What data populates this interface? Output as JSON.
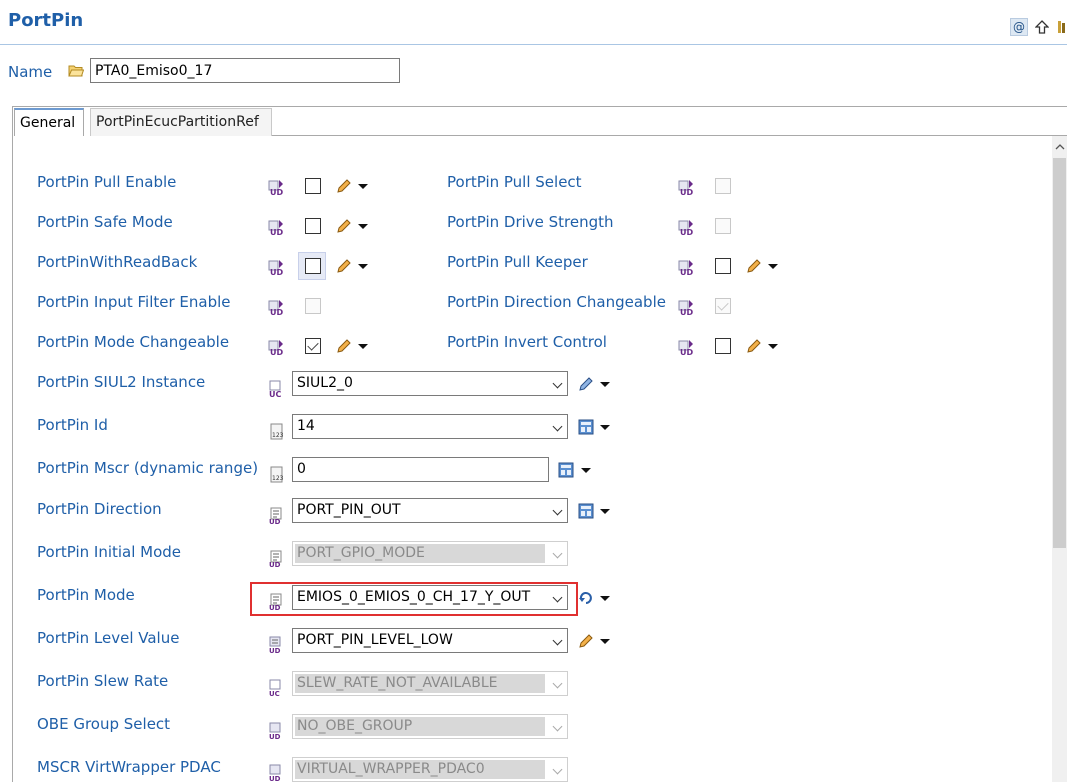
{
  "header": {
    "title": "PortPin"
  },
  "top_icons": [
    "at-icon",
    "up-arrow-icon",
    "library-icon"
  ],
  "name_field": {
    "label": "Name",
    "value": "PTA0_Emiso0_17"
  },
  "tabs": [
    {
      "label": "General",
      "active": true
    },
    {
      "label": "PortPinEcucPartitionRef",
      "active": false
    }
  ],
  "left_checks": [
    {
      "label": "PortPin Pull Enable",
      "checked": false,
      "enabled": true
    },
    {
      "label": "PortPin Safe Mode",
      "checked": false,
      "enabled": true
    },
    {
      "label": "PortPinWithReadBack",
      "checked": false,
      "enabled": true
    },
    {
      "label": "PortPin Input Filter Enable",
      "checked": false,
      "enabled": false
    },
    {
      "label": "PortPin Mode Changeable",
      "checked": true,
      "enabled": true
    }
  ],
  "right_checks": [
    {
      "label": "PortPin Pull Select",
      "checked": false,
      "enabled": false
    },
    {
      "label": "PortPin Drive Strength",
      "checked": false,
      "enabled": false
    },
    {
      "label": "PortPin Pull Keeper",
      "checked": false,
      "enabled": true
    },
    {
      "label": "PortPin Direction Changeable",
      "checked": true,
      "enabled": false
    },
    {
      "label": "PortPin Invert Control",
      "checked": false,
      "enabled": true
    }
  ],
  "fields": [
    {
      "label": "PortPin SIUL2 Instance",
      "value": "SIUL2_0",
      "type": "combo",
      "enabled": true
    },
    {
      "label": "PortPin Id",
      "value": "14",
      "type": "combo",
      "enabled": true
    },
    {
      "label": "PortPin Mscr (dynamic range)",
      "value": "0",
      "type": "input",
      "enabled": true
    },
    {
      "label": "PortPin Direction",
      "value": "PORT_PIN_OUT",
      "type": "combo",
      "enabled": true
    },
    {
      "label": "PortPin Initial Mode",
      "value": "PORT_GPIO_MODE",
      "type": "combo",
      "enabled": false
    },
    {
      "label": "PortPin Mode",
      "value": "EMIOS_0_EMIOS_0_CH_17_Y_OUT",
      "type": "combo",
      "enabled": true,
      "highlighted": true
    },
    {
      "label": "PortPin Level Value",
      "value": "PORT_PIN_LEVEL_LOW",
      "type": "combo",
      "enabled": true
    },
    {
      "label": "PortPin Slew Rate",
      "value": "SLEW_RATE_NOT_AVAILABLE",
      "type": "combo",
      "enabled": false
    },
    {
      "label": "OBE Group Select",
      "value": "NO_OBE_GROUP",
      "type": "combo",
      "enabled": false
    },
    {
      "label": "MSCR VirtWrapper PDAC",
      "value": "VIRTUAL_WRAPPER_PDAC0",
      "type": "combo",
      "enabled": false
    }
  ],
  "colors": {
    "label": "#1f5fa8",
    "highlight": "#e03030",
    "tab_accent": "#6d9ad0"
  }
}
